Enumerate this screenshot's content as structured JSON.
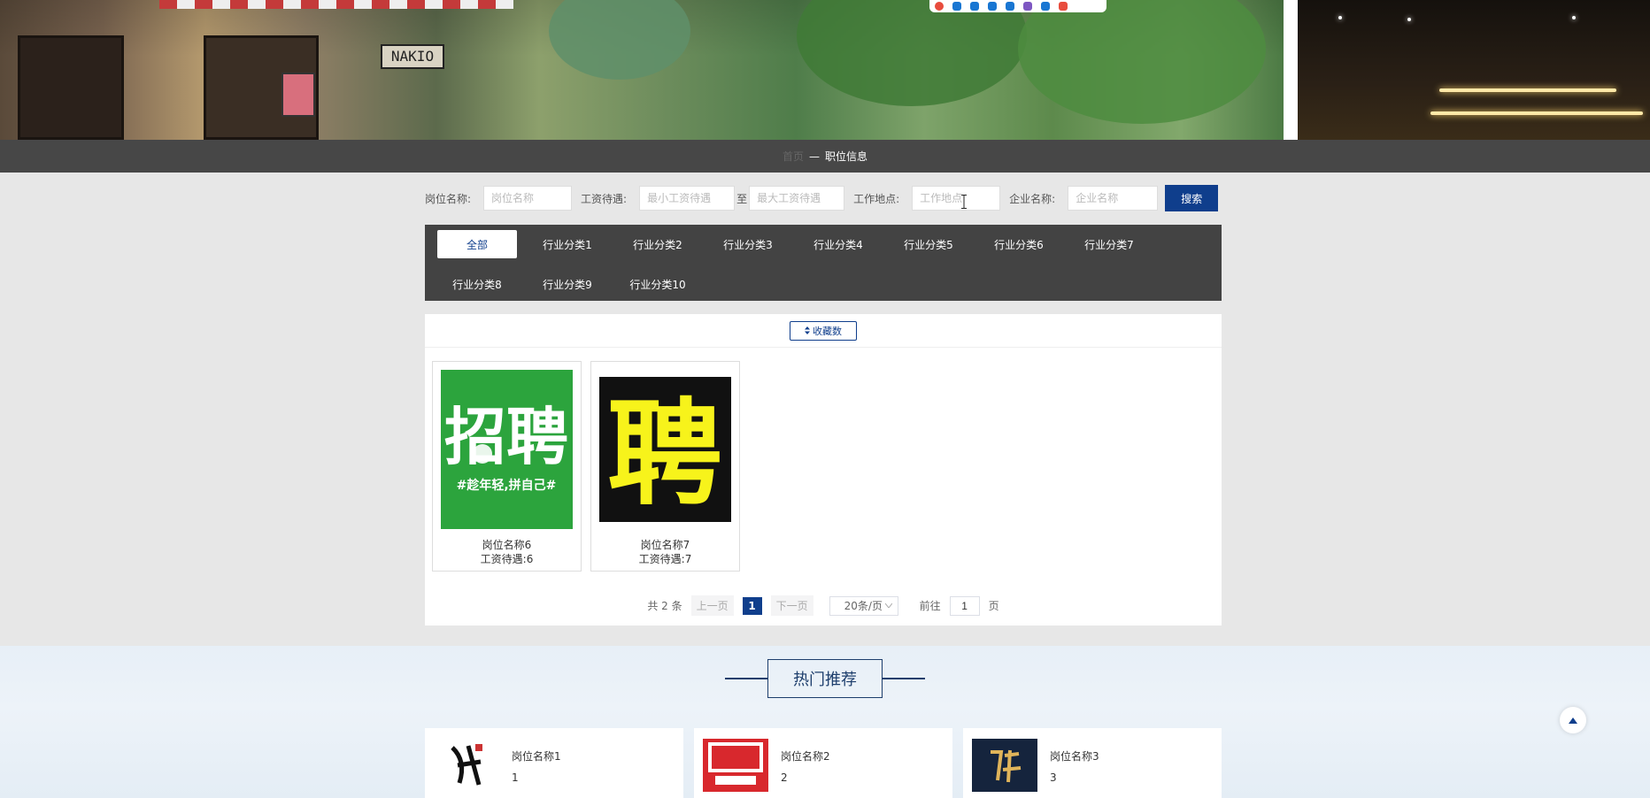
{
  "banner": {
    "sign_text": "NAKIO"
  },
  "breadcrumb": {
    "home": "首页",
    "separator": "—",
    "current": "职位信息"
  },
  "search": {
    "position_label": "岗位名称:",
    "position_placeholder": "岗位名称",
    "salary_label": "工资待遇:",
    "salary_min_placeholder": "最小工资待遇",
    "salary_to": "至",
    "salary_max_placeholder": "最大工资待遇",
    "location_label": "工作地点:",
    "location_placeholder": "工作地点",
    "company_label": "企业名称:",
    "company_placeholder": "企业名称",
    "search_button": "搜索"
  },
  "categories": [
    "全部",
    "行业分类1",
    "行业分类2",
    "行业分类3",
    "行业分类4",
    "行业分类5",
    "行业分类6",
    "行业分类7",
    "行业分类8",
    "行业分类9",
    "行业分类10"
  ],
  "active_category": "全部",
  "sort": {
    "label": "收藏数",
    "icon": "sort-icon"
  },
  "jobs": [
    {
      "name": "岗位名称6",
      "salary": "工资待遇:6",
      "poster_text": "招聘",
      "poster_sub": "#趁年轻,拼自己#"
    },
    {
      "name": "岗位名称7",
      "salary": "工资待遇:7",
      "poster_text": "聘"
    }
  ],
  "pagination": {
    "total": "共 2 条",
    "prev": "上一页",
    "current_page": "1",
    "next": "下一页",
    "page_size": "20条/页",
    "goto_label": "前往",
    "goto_value": "1",
    "page_unit": "页"
  },
  "hot": {
    "title": "热门推荐",
    "items": [
      {
        "name": "岗位名称1",
        "value": "1"
      },
      {
        "name": "岗位名称2",
        "value": "2"
      },
      {
        "name": "岗位名称3",
        "value": "3"
      }
    ]
  },
  "colors": {
    "primary": "#0f3e8c",
    "dark_bar": "#434343",
    "poster_green": "#2ca43d"
  }
}
